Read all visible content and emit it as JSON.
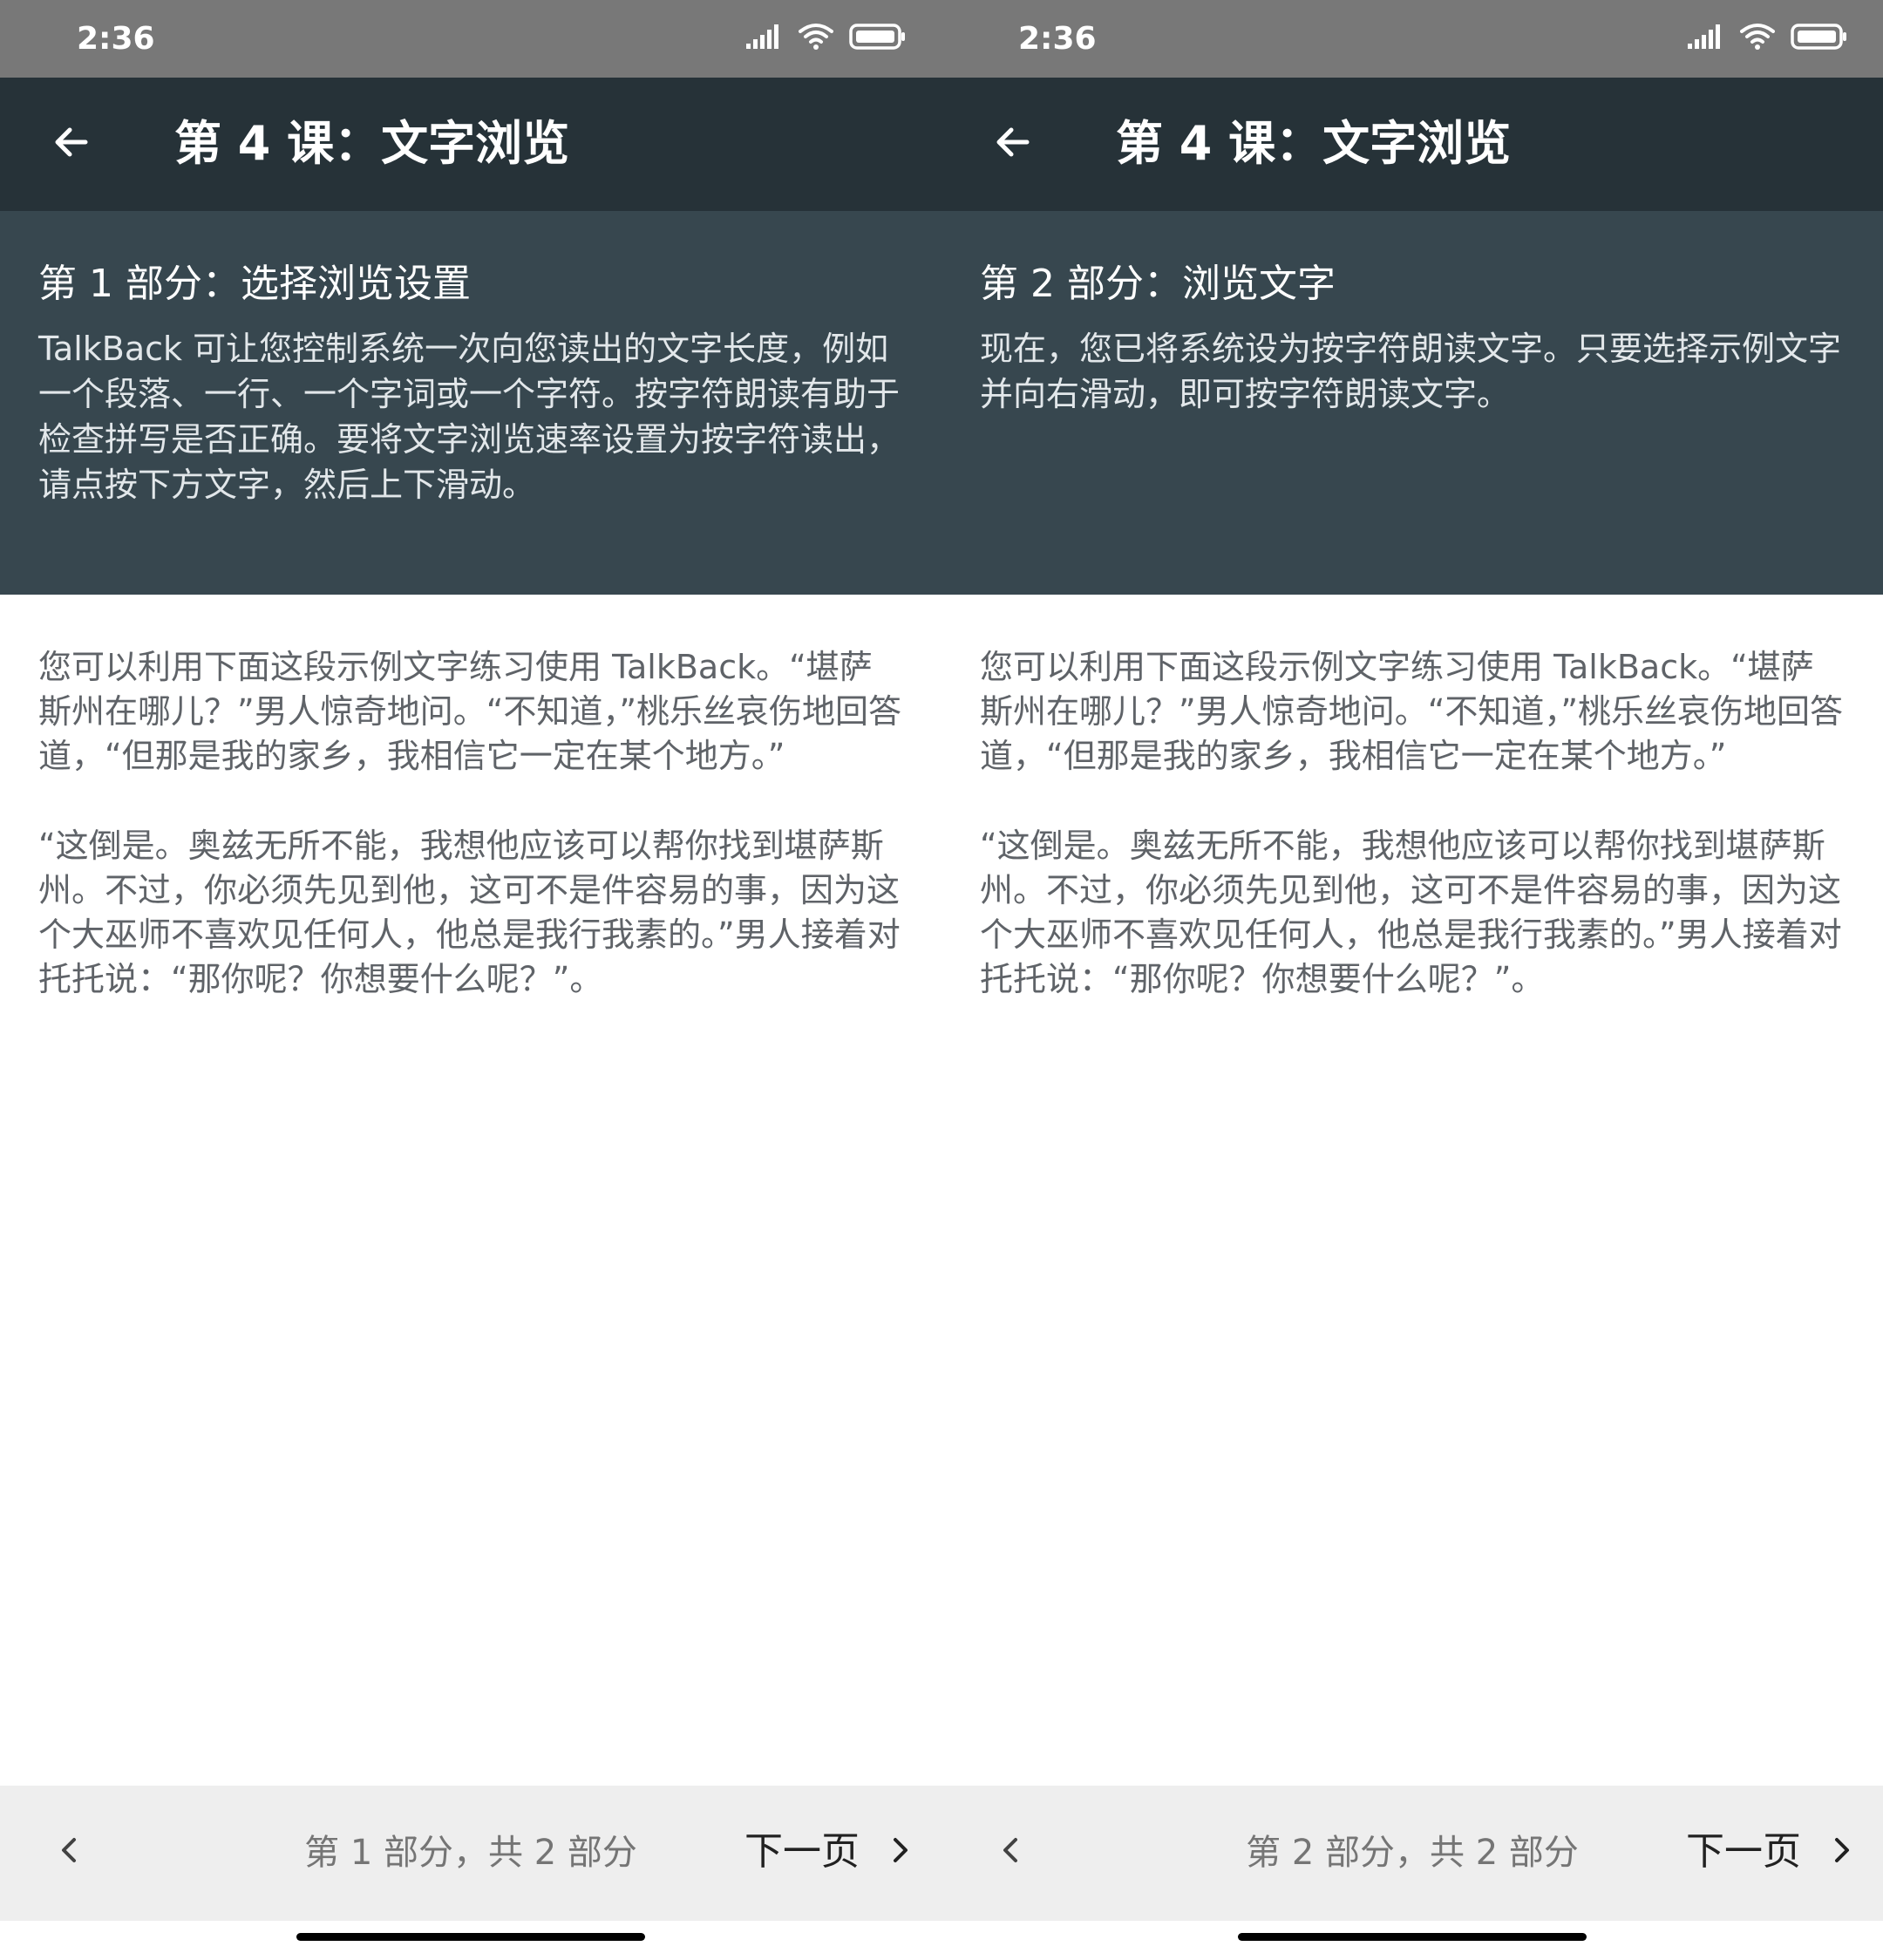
{
  "status_bar": {
    "time": "2:36"
  },
  "colors": {
    "status_bar_bg": "#787878",
    "app_bar_bg": "#263238",
    "intro_bg": "#37474f",
    "footer_bg": "#eeeeee",
    "body_text": "#5f6368"
  },
  "icons": {
    "back": "arrow-left-icon",
    "prev": "chevron-left-icon",
    "next": "chevron-right-icon",
    "signal": "signal-icon",
    "wifi": "wifi-icon",
    "battery": "battery-icon"
  },
  "screens": [
    {
      "title": "第 4 课：文字浏览",
      "section_heading": "第 1 部分：选择浏览设置",
      "section_body": "TalkBack 可让您控制系统一次向您读出的文字长度，例如一个段落、一行、一个字词或一个字符。按字符朗读有助于检查拼写是否正确。要将文字浏览速率设置为按字符读出，请点按下方文字，然后上下滑动。",
      "sample_paragraphs": [
        "您可以利用下面这段示例文字练习使用 TalkBack。“堪萨斯州在哪儿？”男人惊奇地问。“不知道，”桃乐丝哀伤地回答道，“但那是我的家乡，我相信它一定在某个地方。”",
        "“这倒是。奥兹无所不能，我想他应该可以帮你找到堪萨斯州。不过，你必须先见到他，这可不是件容易的事，因为这个大巫师不喜欢见任何人，他总是我行我素的。”男人接着对托托说：“那你呢？你想要什么呢？”。"
      ],
      "page_indicator": "第 1 部分，共 2 部分",
      "next_label": "下一页"
    },
    {
      "title": "第 4 课：文字浏览",
      "section_heading": "第 2 部分：浏览文字",
      "section_body": "现在，您已将系统设为按字符朗读文字。只要选择示例文字并向右滑动，即可按字符朗读文字。",
      "sample_paragraphs": [
        "您可以利用下面这段示例文字练习使用 TalkBack。“堪萨斯州在哪儿？”男人惊奇地问。“不知道，”桃乐丝哀伤地回答道，“但那是我的家乡，我相信它一定在某个地方。”",
        "“这倒是。奥兹无所不能，我想他应该可以帮你找到堪萨斯州。不过，你必须先见到他，这可不是件容易的事，因为这个大巫师不喜欢见任何人，他总是我行我素的。”男人接着对托托说：“那你呢？你想要什么呢？”。"
      ],
      "page_indicator": "第 2 部分，共 2 部分",
      "next_label": "下一页"
    }
  ]
}
